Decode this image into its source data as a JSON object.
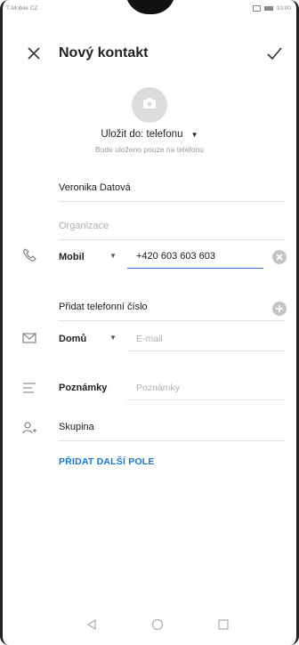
{
  "status_bar": {
    "carrier": "T-Mobile CZ",
    "time": "10:00"
  },
  "header": {
    "title": "Nový kontakt"
  },
  "save_location": {
    "label": "Uložit do: telefonu",
    "note": "Bude uloženo pouze na telefonu"
  },
  "fields": {
    "name": {
      "value": "Veronika Datová"
    },
    "organization": {
      "placeholder": "Organizace"
    },
    "phone": {
      "type_label": "Mobil",
      "value": "+420 603 603 603"
    },
    "add_phone": {
      "label": "Přidat telefonní číslo"
    },
    "email": {
      "type_label": "Domů",
      "placeholder": "E-mail"
    },
    "notes": {
      "label": "Poznámky",
      "placeholder": "Poznámky"
    },
    "group": {
      "label": "Skupina"
    }
  },
  "add_more": {
    "label": "PŘIDAT DALŠÍ POLE"
  },
  "colors": {
    "accent": "#1976d2",
    "text": "#222222",
    "hint": "#b0b0b0",
    "divider": "#e2e2e2"
  }
}
